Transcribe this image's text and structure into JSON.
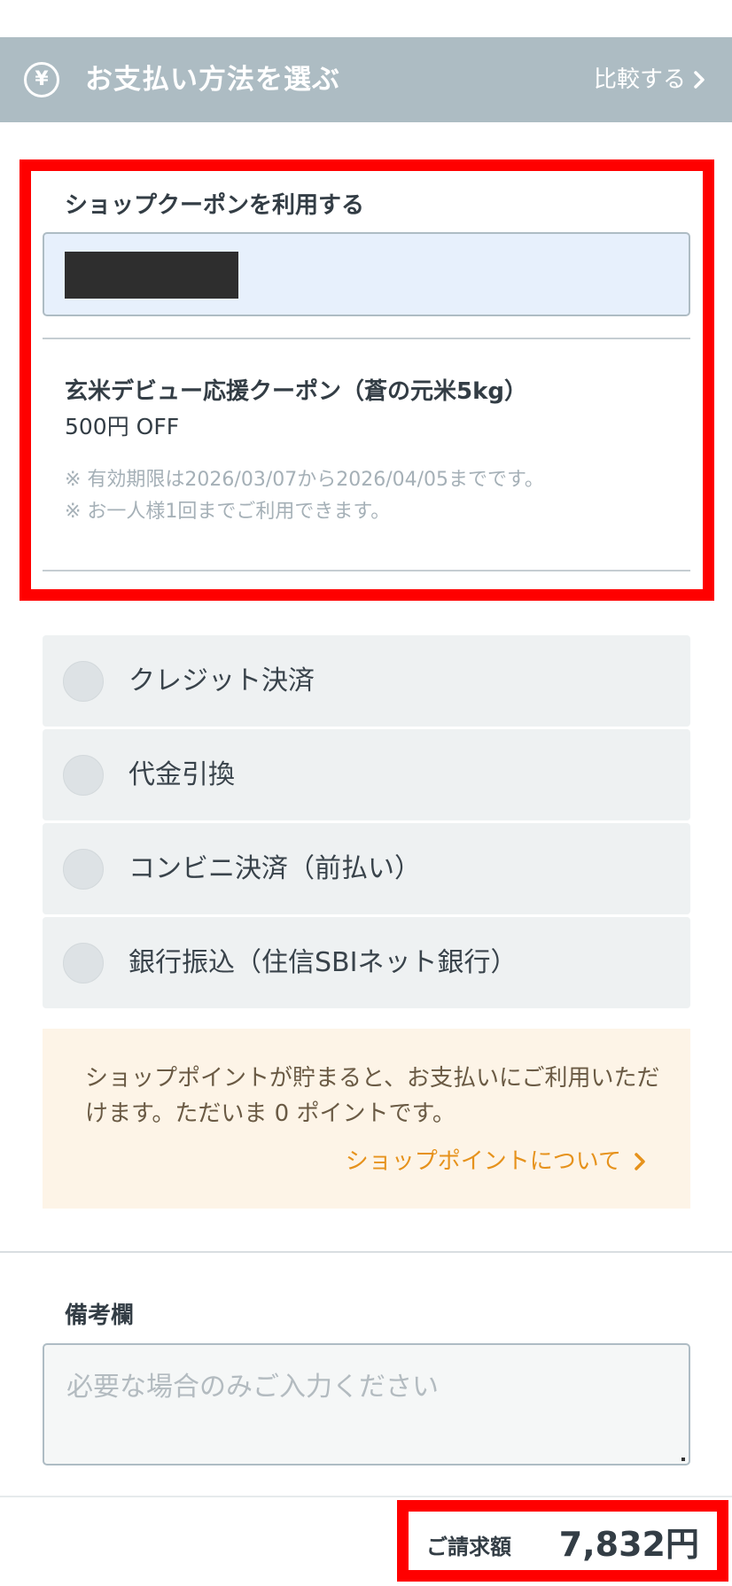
{
  "header": {
    "icon": "yen-icon",
    "icon_glyph": "¥",
    "title": "お支払い方法を選ぶ",
    "compare_label": "比較する"
  },
  "coupon": {
    "label": "ショップクーポンを利用する",
    "input_value": "",
    "name": "玄米デビュー応援クーポン（蒼の元米5kg）",
    "discount": "500円 OFF",
    "notes": [
      "※ 有効期限は2026/03/07から2026/04/05までです。",
      "※ お一人様1回までご利用できます。"
    ]
  },
  "payment_methods": [
    {
      "label": "クレジット決済",
      "selected": false
    },
    {
      "label": "代金引換",
      "selected": false
    },
    {
      "label": "コンビニ決済（前払い）",
      "selected": false
    },
    {
      "label": "銀行振込（住信SBIネット銀行）",
      "selected": false
    }
  ],
  "points": {
    "message": "ショップポイントが貯まると、お支払いにご利用いただけます。ただいま 0 ポイントです。",
    "link_label": "ショップポイントについて"
  },
  "notes": {
    "label": "備考欄",
    "placeholder": "必要な場合のみご入力ください",
    "value": ""
  },
  "total": {
    "label": "ご請求額",
    "amount": "7,832円"
  },
  "colors": {
    "header_bg": "#adbcc3",
    "highlight_border": "#ff0000",
    "coupon_input_bg": "#e7f0fc",
    "points_bg": "#fdf4e7",
    "points_link": "#e6921c"
  }
}
